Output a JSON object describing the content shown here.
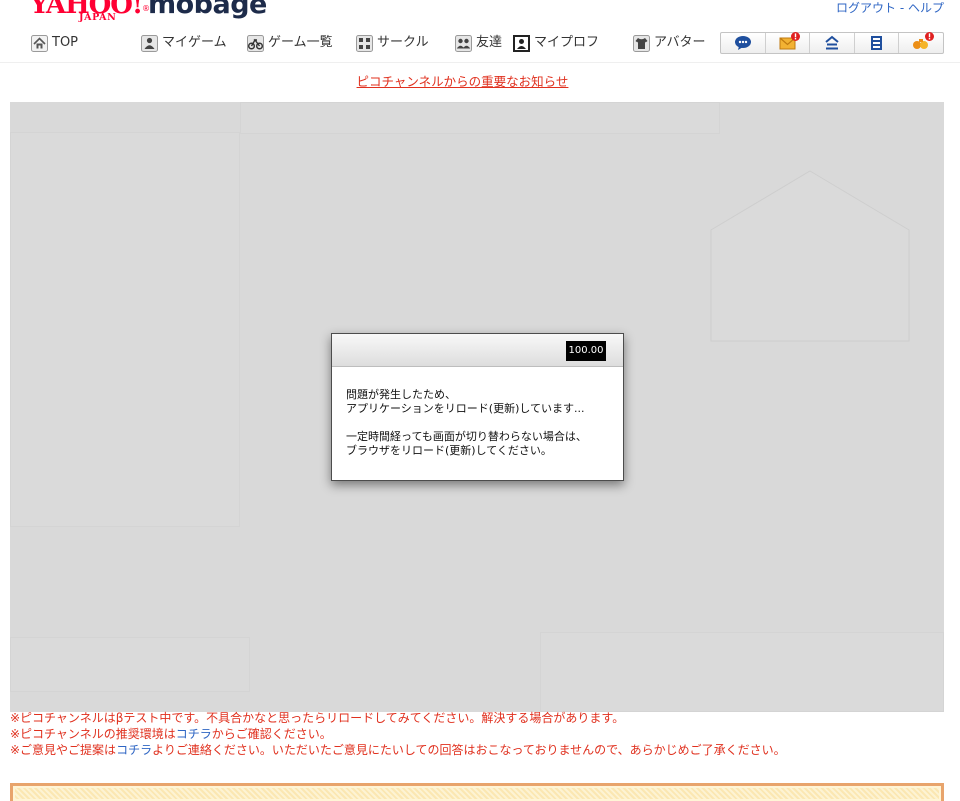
{
  "header": {
    "logo": {
      "yahoo": "YAHOO!",
      "registered": "®",
      "japan": "JAPAN",
      "mobage": "mobage"
    },
    "account_links": {
      "logout": "ログアウト",
      "separator": " - ",
      "help": "ヘルプ"
    }
  },
  "nav": {
    "items": [
      {
        "label": "TOP",
        "icon": "home-icon"
      },
      {
        "label": "マイゲーム",
        "icon": "my-game-icon"
      },
      {
        "label": "ゲーム一覧",
        "icon": "game-list-icon"
      },
      {
        "label": "サークル",
        "icon": "circle-icon"
      },
      {
        "label": "友達",
        "icon": "friends-icon"
      },
      {
        "label": "マイプロフ",
        "icon": "profile-icon"
      },
      {
        "label": "アバター",
        "icon": "avatar-icon"
      }
    ],
    "quick_icons": [
      {
        "icon": "chat-icon",
        "has_notification": false
      },
      {
        "icon": "mail-icon",
        "has_notification": true
      },
      {
        "icon": "town-icon",
        "has_notification": false
      },
      {
        "icon": "diary-icon",
        "has_notification": false
      },
      {
        "icon": "activity-icon",
        "has_notification": true
      }
    ]
  },
  "notice": {
    "link_text": "ピコチャンネルからの重要なお知らせ"
  },
  "dialog": {
    "badge": "100.00",
    "message": [
      "問題が発生したため、",
      "アプリケーションをリロード(更新)しています..."
    ],
    "hint": [
      "一定時間経っても画面が切り替わらない場合は、",
      "ブラウザをリロード(更新)してください。"
    ]
  },
  "footer": {
    "notes": [
      {
        "text": "※ピコチャンネルはβテスト中です。不具合かなと思ったらリロードしてみてください。解決する場合があります。"
      },
      {
        "prefix": "※ピコチャンネルの推奨環境は",
        "link": "コチラ",
        "suffix": "からご確認ください。"
      },
      {
        "prefix": "※ご意見やご提案は",
        "link": "コチラ",
        "suffix": "よりご連絡ください。いただいたご意見にたいしての回答はおこなっておりませんので、あらかじめご了承ください。"
      }
    ]
  },
  "colors": {
    "yahoo_red": "#ff0033",
    "mobage_navy": "#1d2b4a",
    "alert_red": "#e0301e",
    "link_blue": "#2f66c4",
    "overlay_gray": "#d9d9d9",
    "banner_border": "#e8a46c"
  }
}
